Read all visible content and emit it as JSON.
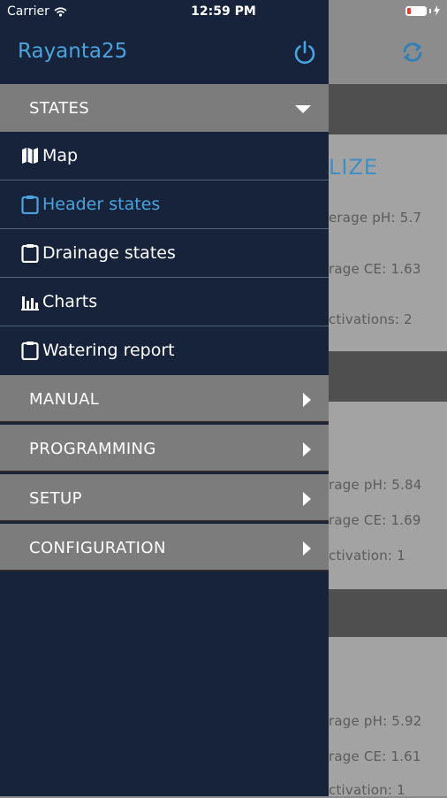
{
  "status_bar": {
    "carrier": "Carrier",
    "time": "12:59 PM"
  },
  "drawer": {
    "title": "Rayanta25",
    "sections": [
      {
        "label": "STATES",
        "expanded": true
      },
      {
        "label": "MANUAL",
        "expanded": false
      },
      {
        "label": "PROGRAMMING",
        "expanded": false
      },
      {
        "label": "SETUP",
        "expanded": false
      },
      {
        "label": "CONFIGURATION",
        "expanded": false
      }
    ],
    "states_items": [
      {
        "label": "Map",
        "icon": "map-icon"
      },
      {
        "label": "Header states",
        "icon": "clipboard-icon",
        "active": true
      },
      {
        "label": "Drainage states",
        "icon": "clipboard-icon"
      },
      {
        "label": "Charts",
        "icon": "bar-chart-icon"
      },
      {
        "label": "Watering report",
        "icon": "clipboard-icon"
      }
    ]
  },
  "background": {
    "card_title": "LIZE",
    "lines": [
      "erage pH: 5.7",
      "rage CE: 1.63",
      "ctivations: 2",
      "rage pH: 5.84",
      "rage CE: 1.69",
      "ctivation: 1",
      "rage pH: 5.92",
      "rage CE: 1.61",
      "ctivation: 1"
    ]
  },
  "colors": {
    "drawer_bg": "#17233a",
    "accent": "#4aa3df",
    "section_bg": "#7c7c7c",
    "battery_low": "#e53935"
  }
}
